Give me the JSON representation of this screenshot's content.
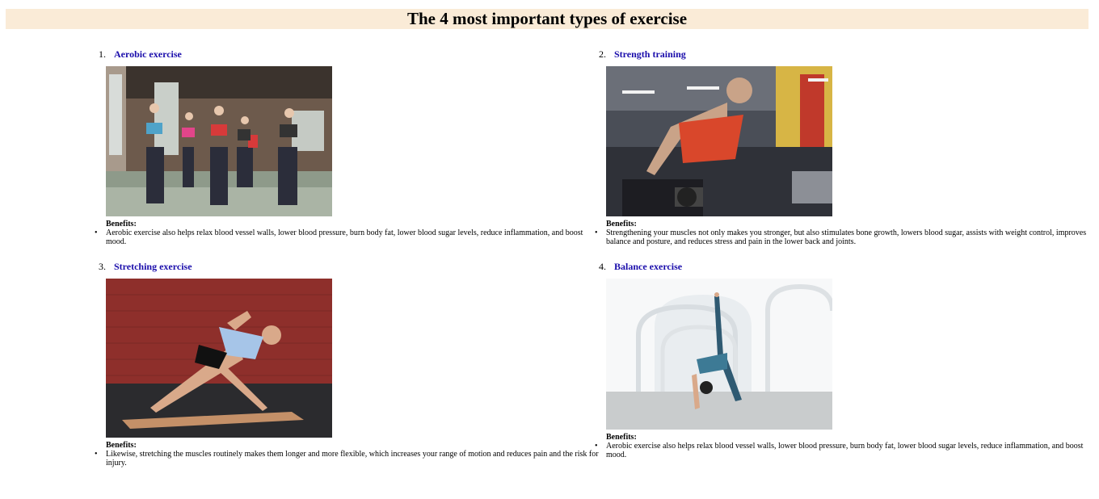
{
  "page": {
    "title": "The 4 most important types of exercise"
  },
  "benefits_label": "Benefits:",
  "items": [
    {
      "number": "1.",
      "title": "Aerobic exercise",
      "benefit": "Aerobic exercise also helps relax blood vessel walls, lower blood pressure, burn body fat, lower blood sugar levels, reduce inflammation, and boost mood."
    },
    {
      "number": "2.",
      "title": "Strength training",
      "benefit": "Strengthening your muscles not only makes you stronger, but also stimulates bone growth, lowers blood sugar, assists with weight control, improves balance and posture, and reduces stress and pain in the lower back and joints."
    },
    {
      "number": "3.",
      "title": "Stretching exercise",
      "benefit": "Likewise, stretching the muscles routinely makes them longer and more flexible, which increases your range of motion and reduces pain and the risk for injury."
    },
    {
      "number": "4.",
      "title": "Balance exercise",
      "benefit": "Aerobic exercise also helps relax blood vessel walls, lower blood pressure, burn body fat, lower blood sugar levels, reduce inflammation, and boost mood."
    }
  ]
}
